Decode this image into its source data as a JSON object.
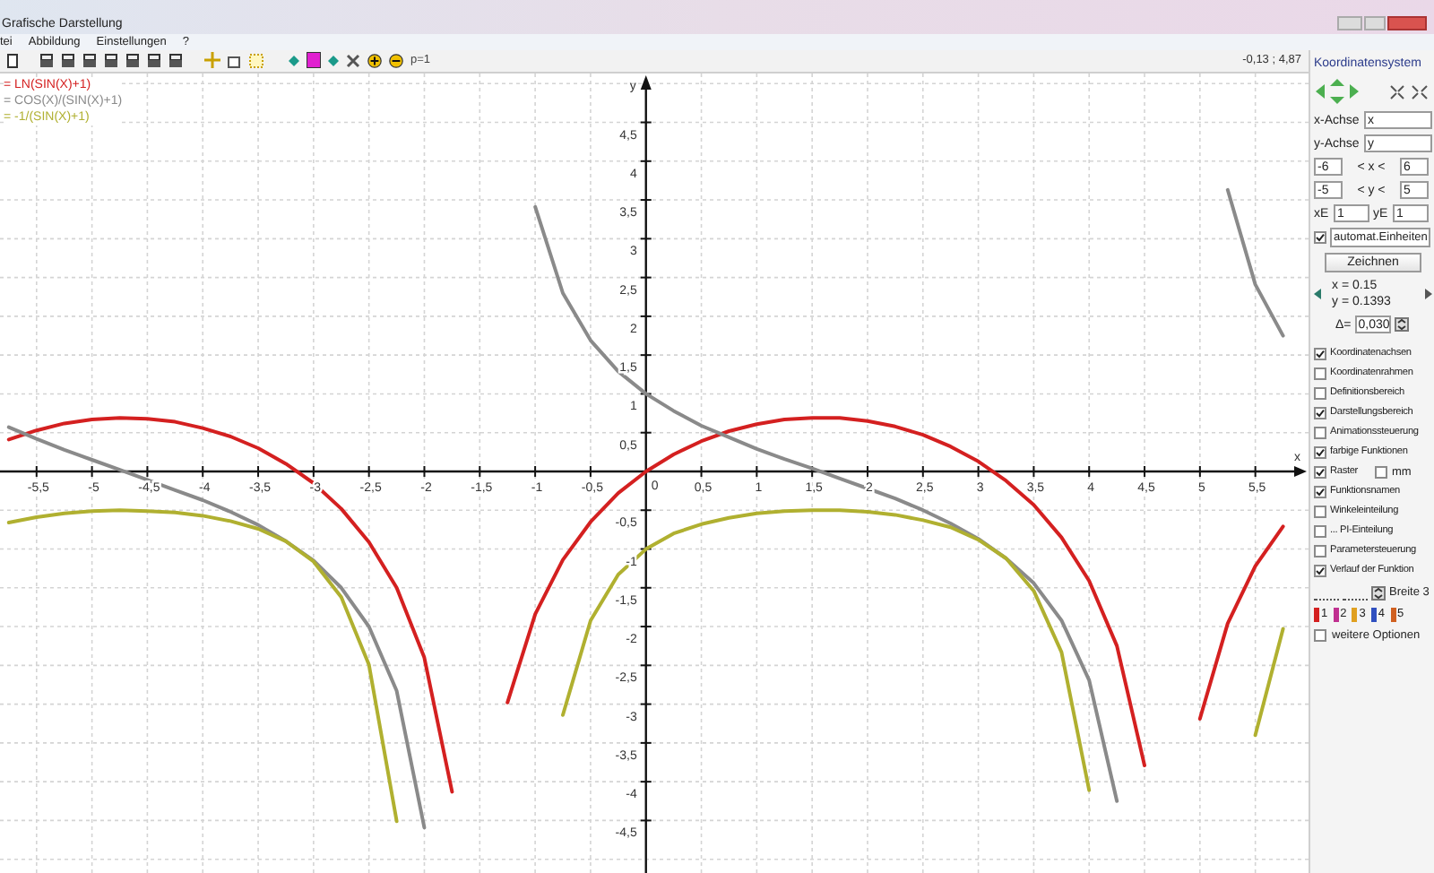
{
  "window": {
    "title": "Grafische Darstellung"
  },
  "menu": [
    "tei",
    "Abbildung",
    "Einstellungen",
    "?"
  ],
  "toolbar": {
    "parameter": "p=1",
    "coordinates": "-0,13 ; 4,87"
  },
  "plot": {
    "chart_data": {
      "type": "line",
      "xlabel": "x",
      "ylabel": "y",
      "xlim": [
        -5.83,
        5.98
      ],
      "ylim": [
        -5.2,
        5.13
      ],
      "x": [
        -5.75,
        -5.5,
        -5.25,
        -5,
        -4.75,
        -4.5,
        -4.25,
        -4,
        -3.75,
        -3.5,
        -3.25,
        -3,
        -2.75,
        -2.5,
        -2.25,
        -2,
        -1.75,
        -1.5,
        -1.25,
        -1,
        -0.75,
        -0.5,
        -0.25,
        0,
        0.25,
        0.5,
        0.75,
        1,
        1.25,
        1.5,
        1.75,
        2,
        2.25,
        2.5,
        2.75,
        3,
        3.25,
        3.5,
        3.75,
        4,
        4.25,
        4.5,
        4.75,
        5,
        5.25,
        5.5,
        5.75
      ],
      "series": [
        {
          "name": "= LN(SIN(X)+1)",
          "color": "#d42020",
          "values": [
            0.41,
            0.53,
            0.62,
            0.67,
            0.69,
            0.68,
            0.64,
            0.56,
            0.45,
            0.3,
            0.1,
            -0.15,
            -0.48,
            -0.91,
            -1.5,
            -2.4,
            -4.13,
            null,
            -2.98,
            -1.84,
            -1.14,
            -0.65,
            -0.28,
            0,
            0.22,
            0.39,
            0.52,
            0.61,
            0.67,
            0.69,
            0.69,
            0.65,
            0.58,
            0.47,
            0.32,
            0.13,
            -0.12,
            -0.43,
            -0.85,
            -1.41,
            -2.25,
            -3.79,
            null,
            -3.19,
            -1.96,
            -1.22,
            -0.71
          ]
        },
        {
          "name": "= COS(X)/(SIN(X)+1)",
          "color": "#8a8a8a",
          "values": [
            0.57,
            0.42,
            0.28,
            0.15,
            0.02,
            -0.11,
            -0.24,
            -0.37,
            -0.52,
            -0.69,
            -0.9,
            -1.15,
            -1.5,
            -2,
            -2.83,
            -4.59,
            null,
            null,
            null,
            3.41,
            2.3,
            1.69,
            1.29,
            1,
            0.78,
            0.59,
            0.44,
            0.29,
            0.16,
            0.04,
            -0.09,
            -0.22,
            -0.35,
            -0.5,
            -0.67,
            -0.87,
            -1.12,
            -1.44,
            -1.92,
            -2.69,
            -4.25,
            null,
            null,
            null,
            3.63,
            2.41,
            1.75
          ]
        },
        {
          "name": "= -1/(SIN(X)+1)",
          "color": "#b0b030",
          "values": [
            -0.66,
            -0.59,
            -0.54,
            -0.51,
            -0.5,
            -0.51,
            -0.53,
            -0.57,
            -0.64,
            -0.74,
            -0.9,
            -1.16,
            -1.62,
            -2.49,
            -4.51,
            null,
            null,
            null,
            null,
            null,
            -3.14,
            -1.92,
            -1.33,
            -1,
            -0.8,
            -0.68,
            -0.6,
            -0.54,
            -0.51,
            -0.5,
            -0.5,
            -0.52,
            -0.56,
            -0.63,
            -0.72,
            -0.88,
            -1.12,
            -1.54,
            -2.33,
            -4.11,
            null,
            null,
            null,
            null,
            null,
            -3.4,
            -2.03
          ]
        }
      ],
      "xticks": [
        {
          "value": -5.5,
          "label": "-5,5"
        },
        {
          "value": -5,
          "label": "-5"
        },
        {
          "value": -4.5,
          "label": "-4,5"
        },
        {
          "value": -4,
          "label": "-4"
        },
        {
          "value": -3.5,
          "label": "-3,5"
        },
        {
          "value": -3,
          "label": "-3"
        },
        {
          "value": -2.5,
          "label": "-2,5"
        },
        {
          "value": -2,
          "label": "-2"
        },
        {
          "value": -1.5,
          "label": "-1,5"
        },
        {
          "value": -1,
          "label": "-1"
        },
        {
          "value": -0.5,
          "label": "-0,5"
        },
        {
          "value": 0.5,
          "label": "0,5"
        },
        {
          "value": 1,
          "label": "1"
        },
        {
          "value": 1.5,
          "label": "1,5"
        },
        {
          "value": 2,
          "label": "2"
        },
        {
          "value": 2.5,
          "label": "2,5"
        },
        {
          "value": 3,
          "label": "3"
        },
        {
          "value": 3.5,
          "label": "3,5"
        },
        {
          "value": 4,
          "label": "4"
        },
        {
          "value": 4.5,
          "label": "4,5"
        },
        {
          "value": 5,
          "label": "5"
        },
        {
          "value": 5.5,
          "label": "5,5"
        }
      ],
      "yticks": [
        {
          "value": 4.5,
          "label": "4,5"
        },
        {
          "value": 4,
          "label": "4"
        },
        {
          "value": 3.5,
          "label": "3,5"
        },
        {
          "value": 3,
          "label": "3"
        },
        {
          "value": 2.5,
          "label": "2,5"
        },
        {
          "value": 2,
          "label": "2"
        },
        {
          "value": 1.5,
          "label": "1,5"
        },
        {
          "value": 1,
          "label": "1"
        },
        {
          "value": 0.5,
          "label": "0,5"
        },
        {
          "value": -0.5,
          "label": "-0,5"
        },
        {
          "value": -1,
          "label": "-1"
        },
        {
          "value": -1.5,
          "label": "-1,5"
        },
        {
          "value": -2,
          "label": "-2"
        },
        {
          "value": -2.5,
          "label": "-2,5"
        },
        {
          "value": -3,
          "label": "-3"
        },
        {
          "value": -3.5,
          "label": "-3,5"
        },
        {
          "value": -4,
          "label": "-4"
        },
        {
          "value": -4.5,
          "label": "-4,5"
        }
      ],
      "grid": true
    },
    "origin_label": "0"
  },
  "panel": {
    "title": "Koordinatensystem",
    "x_axis": {
      "label": "x-Achse",
      "value": "x"
    },
    "y_axis": {
      "label": "y-Achse",
      "value": "y"
    },
    "x_range": {
      "min": "-6",
      "label": "< x <",
      "max": "6"
    },
    "y_range": {
      "min": "-5",
      "label": "< y <",
      "max": "5"
    },
    "units": [
      {
        "label": "xE",
        "value": "1"
      },
      {
        "label": "yE",
        "value": "1"
      }
    ],
    "auto_units": {
      "label": "automat.Einheiten",
      "checked": true
    },
    "draw_button": "Zeichnen",
    "cursor": {
      "x": "x = 0.15",
      "y": "y = 0.1393",
      "delta_label": "Δ=",
      "delta": "0,030"
    },
    "options": [
      {
        "label": "Koordinatenachsen",
        "checked": true
      },
      {
        "label": "Koordinatenrahmen",
        "checked": false
      },
      {
        "label": "Definitionsbereich",
        "checked": false
      },
      {
        "label": "Darstellungsbereich",
        "checked": true
      },
      {
        "label": "Animationssteuerung",
        "checked": false
      },
      {
        "label": "farbige Funktionen",
        "checked": true
      },
      {
        "label": "Raster",
        "checked": true,
        "extra": {
          "label": "mm",
          "checked": false
        }
      },
      {
        "label": "Funktionsnamen",
        "checked": true
      },
      {
        "label": "Winkeleinteilung",
        "checked": false
      },
      {
        "label": "... PI-Einteilung",
        "checked": false
      },
      {
        "label": "Parametersteuerung",
        "checked": false
      },
      {
        "label": "Verlauf der Funktion",
        "checked": true
      }
    ],
    "width_label": "Breite 3",
    "functions": [
      {
        "label": "1",
        "color": "#d42020"
      },
      {
        "label": "2",
        "color": "#c03090"
      },
      {
        "label": "3",
        "color": "#e0a020"
      },
      {
        "label": "4",
        "color": "#3050c0"
      },
      {
        "label": "5",
        "color": "#d06020"
      }
    ],
    "more_options": {
      "label": "weitere Optionen",
      "checked": false
    }
  }
}
